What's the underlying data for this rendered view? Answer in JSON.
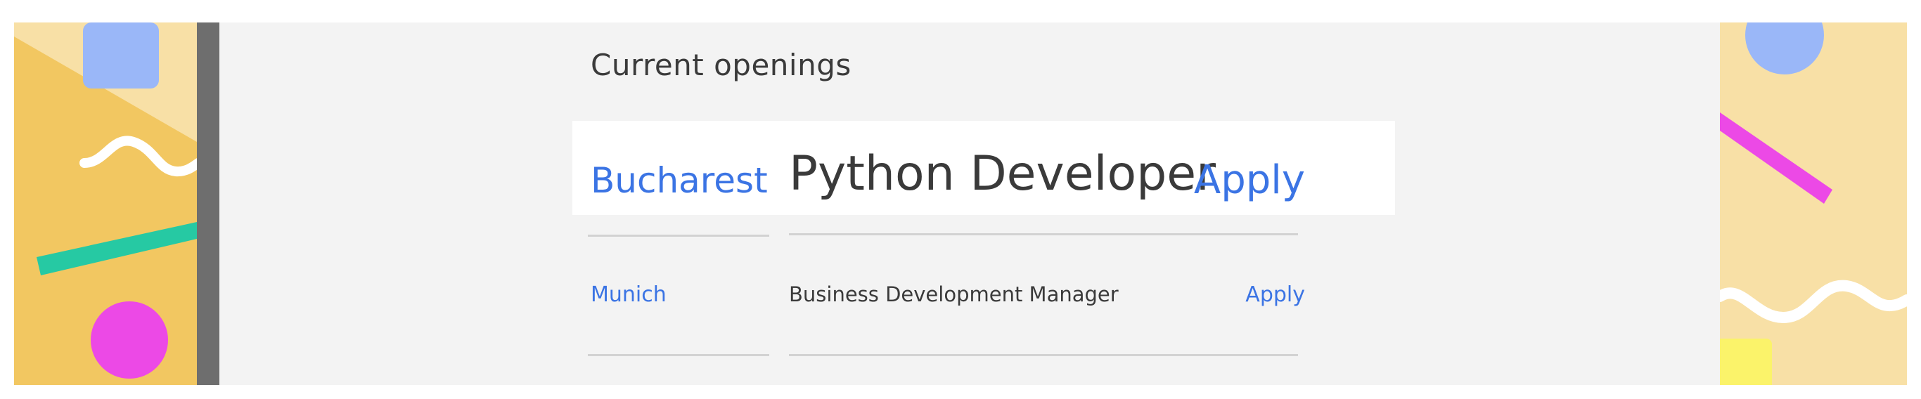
{
  "section": {
    "title": "Current openings"
  },
  "jobs": [
    {
      "city": "Bucharest",
      "title": "Python Developer",
      "apply_label": "Apply"
    },
    {
      "city": "Munich",
      "title": "Business Development Manager",
      "apply_label": "Apply"
    }
  ],
  "colors": {
    "accent": "#3b74e4",
    "text": "#3a3a3a",
    "background": "#f3f3f3",
    "highlight_card": "#ffffff",
    "divider": "#d2d2d2",
    "deco_yellow": "#f2c761",
    "deco_pale_yellow": "#f8e0a6",
    "deco_blue": "#9ab7f8",
    "deco_magenta": "#ec49e6",
    "deco_teal": "#26c9a3",
    "deco_lemon": "#fbf36a",
    "dark_bar": "#6e6e6e"
  }
}
